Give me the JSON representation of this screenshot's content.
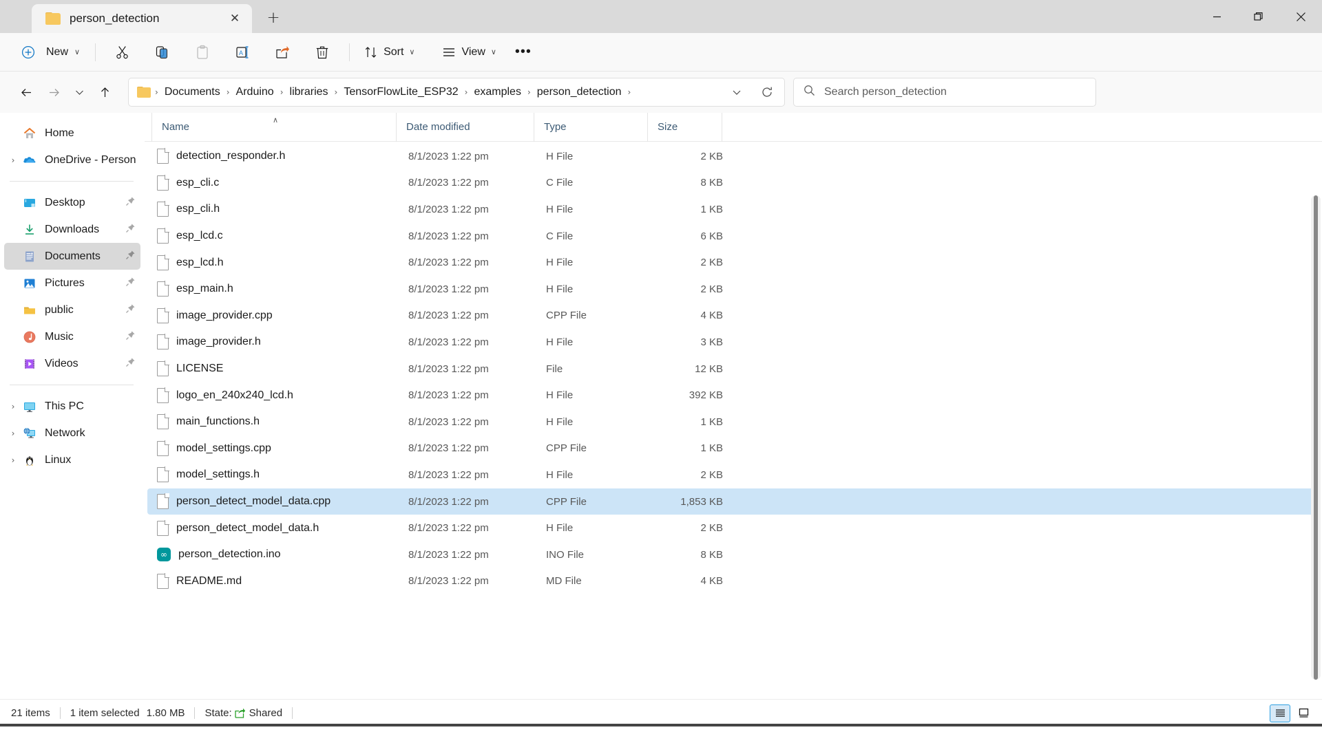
{
  "window": {
    "tab_title": "person_detection",
    "tab_close_label": "✕",
    "new_tab_label": "+",
    "minimize_label": "minimize",
    "maximize_label": "restore",
    "close_label": "close"
  },
  "toolbar": {
    "new_label": "New",
    "new_chevron": "∨",
    "cut_label": "Cut",
    "copy_label": "Copy",
    "paste_label": "Paste",
    "rename_label": "Rename",
    "share_label": "Share",
    "delete_label": "Delete",
    "sort_label": "Sort",
    "sort_chevron": "∨",
    "view_label": "View",
    "view_chevron": "∨",
    "more_label": "•••"
  },
  "address": {
    "back_label": "Back",
    "forward_label": "Forward",
    "recent_chevron": "∨",
    "up_label": "Up",
    "breadcrumbs": [
      "Documents",
      "Arduino",
      "libraries",
      "TensorFlowLite_ESP32",
      "examples",
      "person_detection"
    ],
    "separator": "›",
    "dropdown_chevron": "∨",
    "refresh_label": "Refresh"
  },
  "search": {
    "placeholder": "Search person_detection",
    "value": ""
  },
  "sidebar": {
    "items": [
      {
        "label": "Home",
        "icon": "home-icon",
        "expandable": false,
        "pinned": false,
        "selected": false
      },
      {
        "label": "OneDrive - Persona",
        "icon": "onedrive-icon",
        "expandable": true,
        "pinned": false,
        "selected": false
      },
      {
        "divider": true
      },
      {
        "label": "Desktop",
        "icon": "desktop-icon",
        "expandable": false,
        "pinned": true,
        "selected": false
      },
      {
        "label": "Downloads",
        "icon": "downloads-icon",
        "expandable": false,
        "pinned": true,
        "selected": false
      },
      {
        "label": "Documents",
        "icon": "documents-icon",
        "expandable": false,
        "pinned": true,
        "selected": true
      },
      {
        "label": "Pictures",
        "icon": "pictures-icon",
        "expandable": false,
        "pinned": true,
        "selected": false
      },
      {
        "label": "public",
        "icon": "folder-icon",
        "expandable": false,
        "pinned": true,
        "selected": false
      },
      {
        "label": "Music",
        "icon": "music-icon",
        "expandable": false,
        "pinned": true,
        "selected": false
      },
      {
        "label": "Videos",
        "icon": "videos-icon",
        "expandable": false,
        "pinned": true,
        "selected": false
      },
      {
        "divider": true
      },
      {
        "label": "This PC",
        "icon": "thispc-icon",
        "expandable": true,
        "pinned": false,
        "selected": false
      },
      {
        "label": "Network",
        "icon": "network-icon",
        "expandable": true,
        "pinned": false,
        "selected": false
      },
      {
        "label": "Linux",
        "icon": "linux-icon",
        "expandable": true,
        "pinned": false,
        "selected": false
      }
    ],
    "expand_glyph": "›",
    "pin_glyph": "📌"
  },
  "columns": {
    "name": "Name",
    "date_modified": "Date modified",
    "type": "Type",
    "size": "Size",
    "sort_glyph": "∧"
  },
  "files": [
    {
      "name": "detection_responder.h",
      "date": "8/1/2023 1:22 pm",
      "type": "H File",
      "size": "2 KB",
      "icon": "document-icon",
      "selected": false
    },
    {
      "name": "esp_cli.c",
      "date": "8/1/2023 1:22 pm",
      "type": "C File",
      "size": "8 KB",
      "icon": "document-icon",
      "selected": false
    },
    {
      "name": "esp_cli.h",
      "date": "8/1/2023 1:22 pm",
      "type": "H File",
      "size": "1 KB",
      "icon": "document-icon",
      "selected": false
    },
    {
      "name": "esp_lcd.c",
      "date": "8/1/2023 1:22 pm",
      "type": "C File",
      "size": "6 KB",
      "icon": "document-icon",
      "selected": false
    },
    {
      "name": "esp_lcd.h",
      "date": "8/1/2023 1:22 pm",
      "type": "H File",
      "size": "2 KB",
      "icon": "document-icon",
      "selected": false
    },
    {
      "name": "esp_main.h",
      "date": "8/1/2023 1:22 pm",
      "type": "H File",
      "size": "2 KB",
      "icon": "document-icon",
      "selected": false
    },
    {
      "name": "image_provider.cpp",
      "date": "8/1/2023 1:22 pm",
      "type": "CPP File",
      "size": "4 KB",
      "icon": "document-icon",
      "selected": false
    },
    {
      "name": "image_provider.h",
      "date": "8/1/2023 1:22 pm",
      "type": "H File",
      "size": "3 KB",
      "icon": "document-icon",
      "selected": false
    },
    {
      "name": "LICENSE",
      "date": "8/1/2023 1:22 pm",
      "type": "File",
      "size": "12 KB",
      "icon": "document-icon",
      "selected": false
    },
    {
      "name": "logo_en_240x240_lcd.h",
      "date": "8/1/2023 1:22 pm",
      "type": "H File",
      "size": "392 KB",
      "icon": "document-icon",
      "selected": false
    },
    {
      "name": "main_functions.h",
      "date": "8/1/2023 1:22 pm",
      "type": "H File",
      "size": "1 KB",
      "icon": "document-icon",
      "selected": false
    },
    {
      "name": "model_settings.cpp",
      "date": "8/1/2023 1:22 pm",
      "type": "CPP File",
      "size": "1 KB",
      "icon": "document-icon",
      "selected": false
    },
    {
      "name": "model_settings.h",
      "date": "8/1/2023 1:22 pm",
      "type": "H File",
      "size": "2 KB",
      "icon": "document-icon",
      "selected": false
    },
    {
      "name": "person_detect_model_data.cpp",
      "date": "8/1/2023 1:22 pm",
      "type": "CPP File",
      "size": "1,853 KB",
      "icon": "document-icon",
      "selected": true
    },
    {
      "name": "person_detect_model_data.h",
      "date": "8/1/2023 1:22 pm",
      "type": "H File",
      "size": "2 KB",
      "icon": "document-icon",
      "selected": false
    },
    {
      "name": "person_detection.ino",
      "date": "8/1/2023 1:22 pm",
      "type": "INO File",
      "size": "8 KB",
      "icon": "arduino-icon",
      "selected": false
    },
    {
      "name": "README.md",
      "date": "8/1/2023 1:22 pm",
      "type": "MD File",
      "size": "4 KB",
      "icon": "document-icon",
      "selected": false
    }
  ],
  "status": {
    "item_count": "21 items",
    "selection": "1 item selected",
    "selection_size": "1.80 MB",
    "state_label": "State:",
    "state_value": "Shared",
    "details_view_label": "Details view",
    "pane_view_label": "Preview pane"
  },
  "colors": {
    "accent": "#2e9fe0",
    "selection": "#cce4f7",
    "folder": "#f7c85f",
    "arduino": "#00979c",
    "shared_green": "#2aa02a",
    "header_text": "#3c5a74"
  }
}
